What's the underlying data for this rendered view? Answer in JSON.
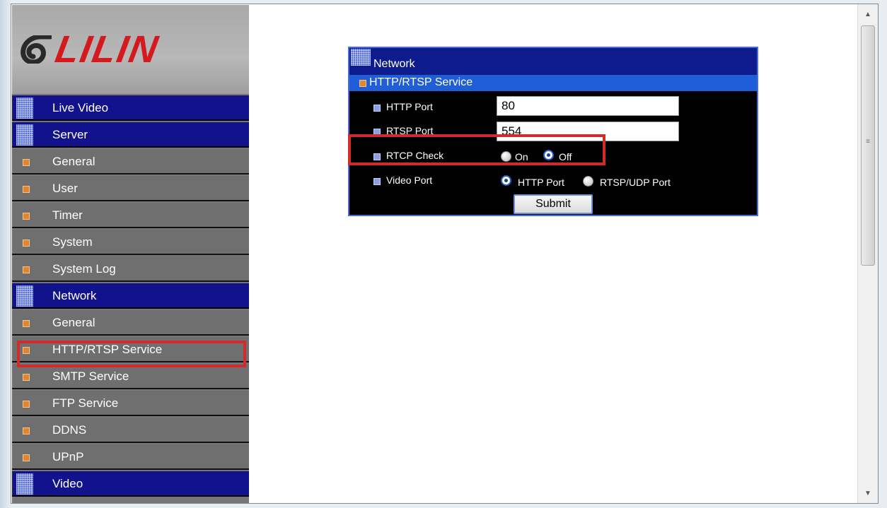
{
  "brand": {
    "logo_text": "LILIN",
    "logo_color": "#d21a1f"
  },
  "sidebar": {
    "items": [
      {
        "label": "Live Video",
        "type": "section"
      },
      {
        "label": "Server",
        "type": "section"
      },
      {
        "label": "General",
        "type": "sub"
      },
      {
        "label": "User",
        "type": "sub"
      },
      {
        "label": "Timer",
        "type": "sub"
      },
      {
        "label": "System",
        "type": "sub"
      },
      {
        "label": "System Log",
        "type": "sub"
      },
      {
        "label": "Network",
        "type": "section"
      },
      {
        "label": "General",
        "type": "sub"
      },
      {
        "label": "HTTP/RTSP Service",
        "type": "sub",
        "highlighted": true
      },
      {
        "label": "SMTP Service",
        "type": "sub"
      },
      {
        "label": "FTP Service",
        "type": "sub"
      },
      {
        "label": "DDNS",
        "type": "sub"
      },
      {
        "label": "UPnP",
        "type": "sub"
      },
      {
        "label": "Video",
        "type": "section"
      }
    ]
  },
  "panel": {
    "title": "Network",
    "subtitle": "HTTP/RTSP Service",
    "http_port": {
      "label": "HTTP Port",
      "value": "80"
    },
    "rtsp_port": {
      "label": "RTSP Port",
      "value": "554"
    },
    "rtcp_check": {
      "label": "RTCP Check",
      "option_on": "On",
      "option_off": "Off",
      "selected": "Off"
    },
    "video_port": {
      "label": "Video Port",
      "option_http": "HTTP Port",
      "option_rtsp": "RTSP/UDP Port",
      "selected": "HTTP Port"
    },
    "submit_label": "Submit"
  },
  "colors": {
    "section_bg": "#12128c",
    "sub_bg": "#6f6f6f",
    "highlight": "#d22b2b",
    "panel_sub_bg": "#1f5ed6"
  }
}
